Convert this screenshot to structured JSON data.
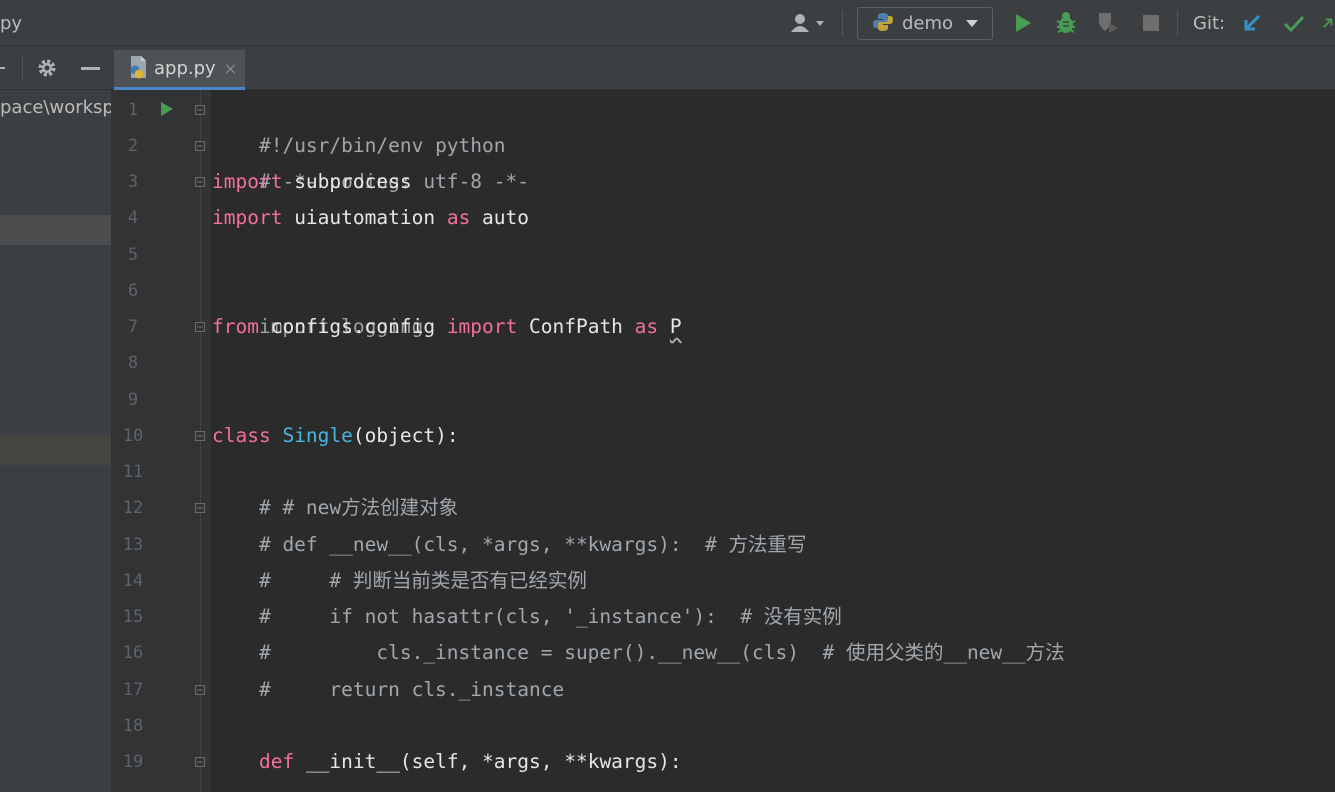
{
  "window": {
    "title": "py"
  },
  "toolbar": {
    "run_config": "demo",
    "git_label": "Git:"
  },
  "project": {
    "path": "pace\\workspa"
  },
  "tabs": [
    {
      "label": "app.py",
      "close": "×"
    }
  ],
  "colors": {
    "keyword": "#f26f9e",
    "class_name": "#48b6e0",
    "comment": "#a0a7ad",
    "run_green": "#499c54",
    "git_blue": "#3592c4"
  },
  "editor": {
    "line_numbers": [
      "1",
      "2",
      "3",
      "4",
      "5",
      "6",
      "7",
      "8",
      "9",
      "10",
      "11",
      "12",
      "13",
      "14",
      "15",
      "16",
      "17",
      "18",
      "19"
    ],
    "lines": {
      "l1": "#!/usr/bin/env python",
      "l2": "# -*- coding: utf-8 -*-",
      "l3_kw": "import",
      "l3_rest": " subprocess",
      "l4_kw": "import",
      "l4_a": " uiautomation ",
      "l4_as": "as",
      "l4_b": " auto",
      "l6": "import logging",
      "l7_from": "from",
      "l7_a": " configs.config ",
      "l7_import": "import",
      "l7_b": " ConfPath ",
      "l7_as": "as",
      "l7_c": " ",
      "l7_p": "P",
      "l10_kw": "class",
      "l10_sp": " ",
      "l10_name": "Single",
      "l10_rest": "(object):",
      "l12": "    # # new方法创建对象",
      "l13": "    # def __new__(cls, *args, **kwargs):  # 方法重写",
      "l14": "    #     # 判断当前类是否有已经实例",
      "l15": "    #     if not hasattr(cls, '_instance'):  # 没有实例",
      "l16": "    #         cls._instance = super().__new__(cls)  # 使用父类的__new__方法",
      "l17": "    #     return cls._instance",
      "l19_ind": "    ",
      "l19_kw": "def",
      "l19_rest": " __init__(self, *args, **kwargs):"
    }
  }
}
